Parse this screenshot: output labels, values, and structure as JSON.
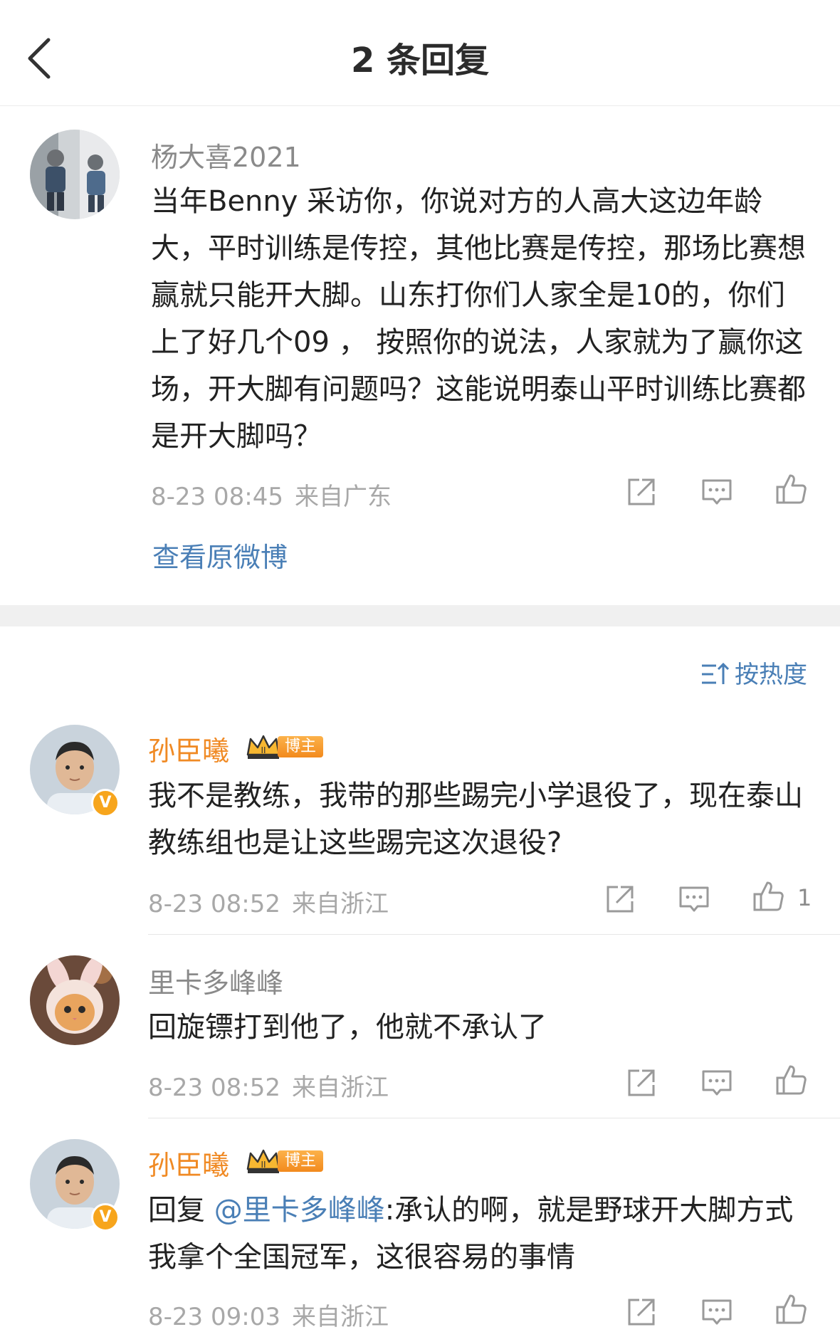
{
  "header": {
    "title": "2 条回复"
  },
  "original": {
    "user": "杨大喜2021",
    "text": "当年Benny 采访你，你说对方的人高大这边年龄大，平时训练是传控，其他比赛是传控，那场比赛想赢就只能开大脚。山东打你们人家全是10的，你们上了好几个09 ， 按照你的说法，人家就为了赢你这场，开大脚有问题吗？这能说明泰山平时训练比赛都是开大脚吗？",
    "time": "8-23 08:45",
    "location": "来自广东",
    "view_original": "查看原微博"
  },
  "sort_label": "按热度",
  "replies": [
    {
      "user": "孙臣曦",
      "badge": "博主",
      "text": "我不是教练，我带的那些踢完小学退役了，现在泰山教练组也是让这些踢完这次退役?",
      "time": "8-23 08:52",
      "location": "来自浙江",
      "likes": "1"
    },
    {
      "user": "里卡多峰峰",
      "text": "回旋镖打到他了，他就不承认了",
      "time": "8-23 08:52",
      "location": "来自浙江"
    },
    {
      "user": "孙臣曦",
      "badge": "博主",
      "reply_prefix": "回复 ",
      "mention": "@里卡多峰峰",
      "text": ":承认的啊，就是野球开大脚方式我拿个全国冠军，这很容易的事情",
      "time": "8-23 09:03",
      "location": "来自浙江"
    }
  ],
  "icons": {
    "back": "chevron-left-icon",
    "share": "share-icon",
    "comment": "comment-icon",
    "like": "thumbs-up-icon",
    "sort": "sort-icon",
    "crown": "crown-icon",
    "verified": "verified-v-icon"
  },
  "colors": {
    "accent_blue": "#4a7fb6",
    "vip_orange": "#f08a24",
    "badge_orange": "#f7a51c"
  }
}
